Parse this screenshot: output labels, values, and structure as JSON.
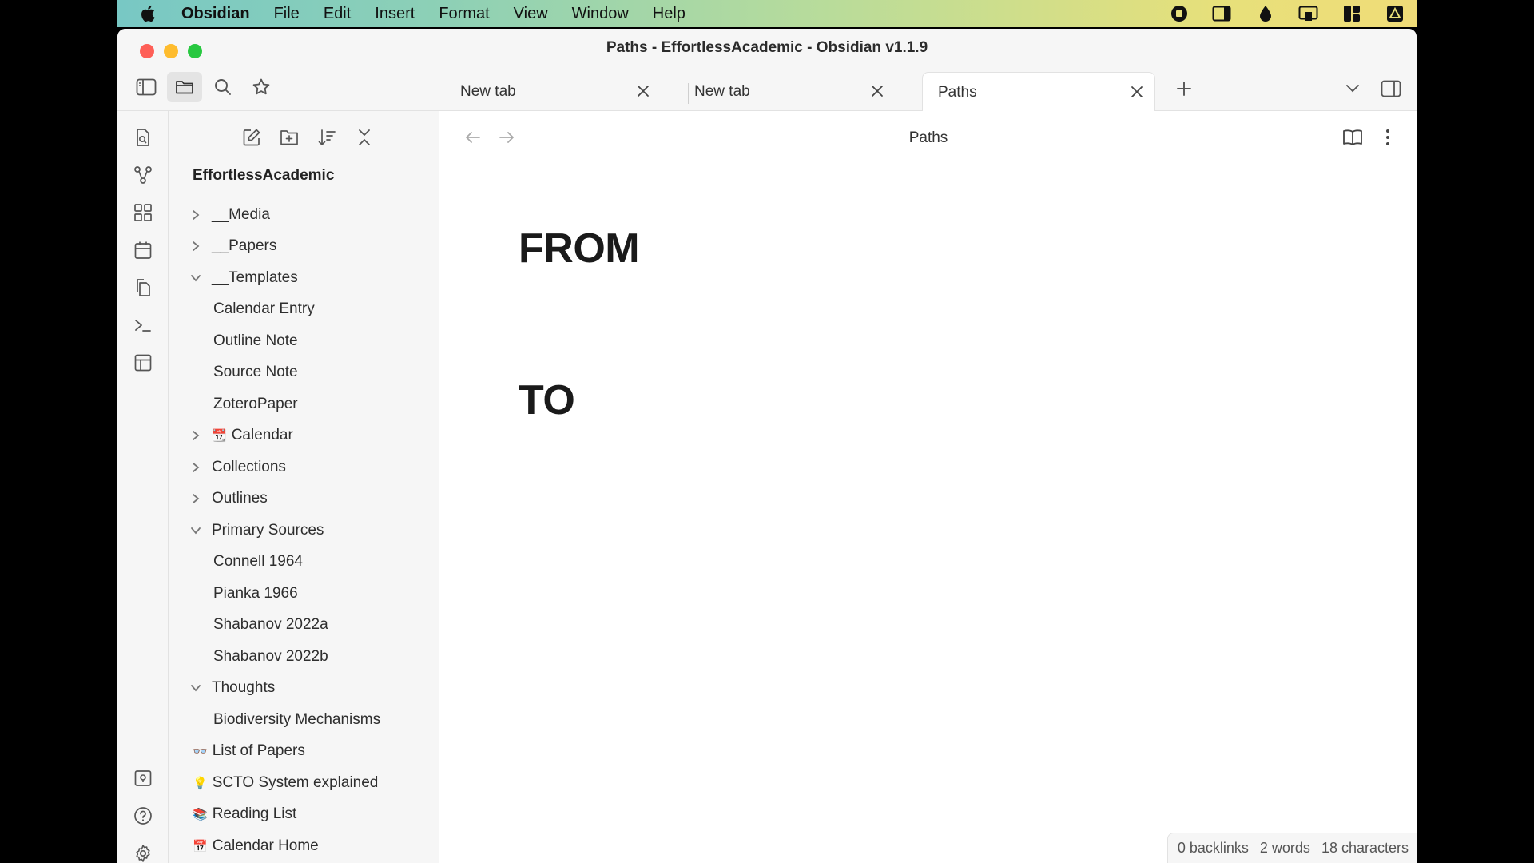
{
  "menubar": {
    "app_name": "Obsidian",
    "items": [
      "File",
      "Edit",
      "Insert",
      "Format",
      "View",
      "Window",
      "Help"
    ]
  },
  "window": {
    "title": "Paths - EffortlessAcademic - Obsidian v1.1.9"
  },
  "tabs": [
    {
      "label": "New tab",
      "active": false
    },
    {
      "label": "New tab",
      "active": false
    },
    {
      "label": "Paths",
      "active": true
    }
  ],
  "explorer": {
    "vault_name": "EffortlessAcademic",
    "items": [
      {
        "label": "__Media",
        "type": "folder",
        "expanded": false
      },
      {
        "label": "__Papers",
        "type": "folder",
        "expanded": false
      },
      {
        "label": "__Templates",
        "type": "folder",
        "expanded": true
      },
      {
        "label": "Calendar Entry",
        "type": "file"
      },
      {
        "label": "Outline Note",
        "type": "file"
      },
      {
        "label": "Source Note",
        "type": "file"
      },
      {
        "label": "ZoteroPaper",
        "type": "file"
      },
      {
        "label": "Calendar",
        "type": "folder",
        "expanded": false,
        "emoji": "📆"
      },
      {
        "label": "Collections",
        "type": "folder",
        "expanded": false
      },
      {
        "label": "Outlines",
        "type": "folder",
        "expanded": false
      },
      {
        "label": "Primary Sources",
        "type": "folder",
        "expanded": true
      },
      {
        "label": "Connell 1964",
        "type": "file"
      },
      {
        "label": "Pianka 1966",
        "type": "file"
      },
      {
        "label": "Shabanov 2022a",
        "type": "file"
      },
      {
        "label": "Shabanov 2022b",
        "type": "file"
      },
      {
        "label": "Thoughts",
        "type": "folder",
        "expanded": true
      },
      {
        "label": "Biodiversity Mechanisms",
        "type": "file"
      },
      {
        "label": "List of Papers",
        "type": "file",
        "emoji": "👓"
      },
      {
        "label": "SCTO System explained",
        "type": "file",
        "emoji": "💡"
      },
      {
        "label": "Reading List",
        "type": "file",
        "emoji": "📚"
      },
      {
        "label": "Calendar Home",
        "type": "file",
        "emoji": "📅"
      }
    ]
  },
  "editor": {
    "view_title": "Paths",
    "headings": [
      "FROM",
      "TO"
    ]
  },
  "statusbar": {
    "backlinks": "0 backlinks",
    "words": "2 words",
    "characters": "18 characters"
  }
}
